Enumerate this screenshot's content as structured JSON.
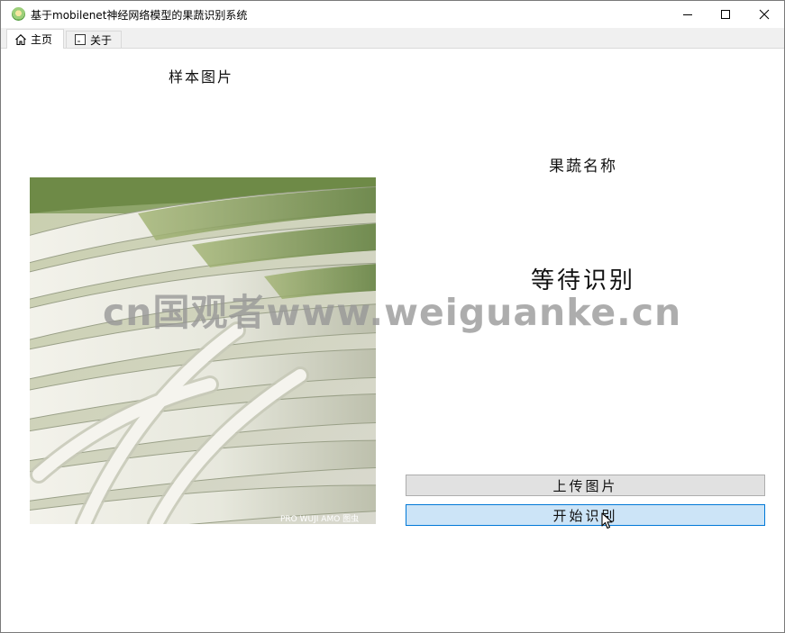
{
  "window": {
    "title": "基于mobilenet神经网络模型的果蔬识别系统",
    "controls": {
      "minimize": "minimize-icon",
      "maximize": "maximize-icon",
      "close": "close-icon"
    }
  },
  "tabs": [
    {
      "label": "主页",
      "icon": "home-icon",
      "selected": true
    },
    {
      "label": "关于",
      "icon": "document-icon",
      "selected": false
    }
  ],
  "main": {
    "sample_title": "样本图片",
    "name_title": "果蔬名称",
    "result_text": "等待识别",
    "upload_button": "上传图片",
    "start_button": "开始识别",
    "image_description": "green onion / scallion stalks",
    "image_caption": "PRO WUJI AMO 图虫"
  },
  "watermark": "cn国观者www.weiguanke.cn",
  "colors": {
    "upload_button_bg": "#e1e1e1",
    "start_button_bg": "#cce4f7",
    "start_button_border": "#0078d7",
    "tab_bar_bg": "#f0f0f0"
  }
}
